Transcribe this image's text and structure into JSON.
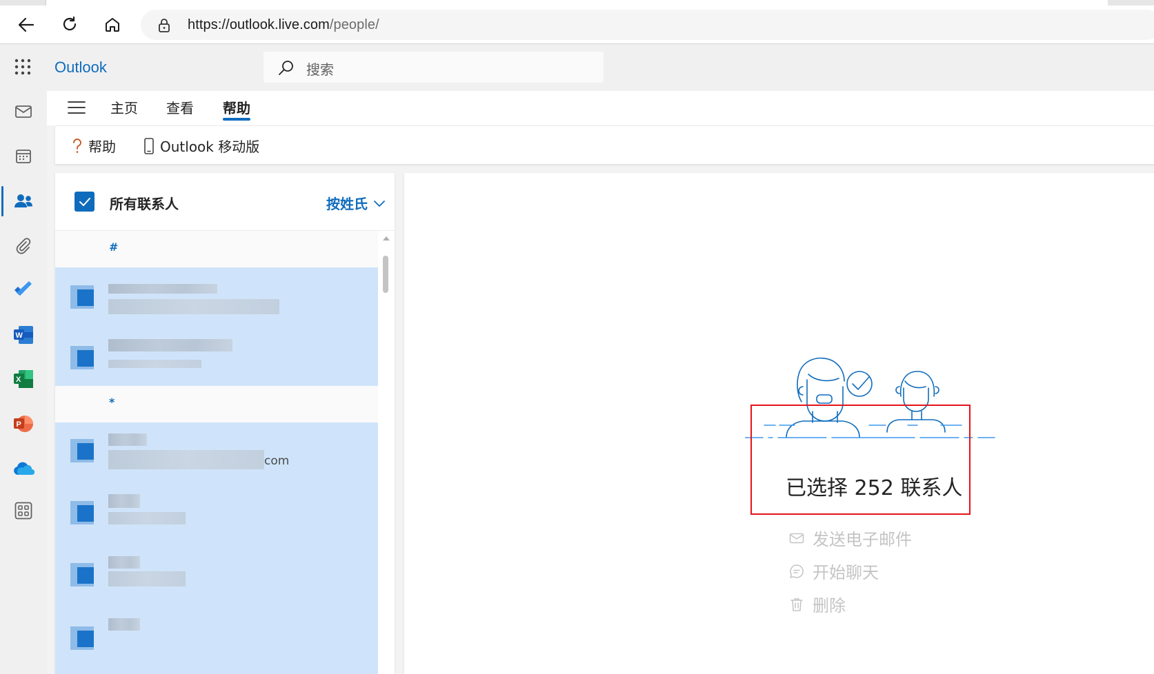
{
  "browser": {
    "url_main": "https://outlook.live.com",
    "url_path": "/people/",
    "icons": [
      "back-arrow-icon",
      "refresh-icon",
      "home-icon",
      "lock-icon"
    ]
  },
  "app": {
    "brand": "Outlook",
    "search_placeholder": "搜索",
    "accent_color": "#0f6cbd"
  },
  "rail": {
    "items": [
      "mail-icon",
      "calendar-icon",
      "people-icon",
      "attachment-icon",
      "todo-icon",
      "word-icon",
      "excel-icon",
      "powerpoint-icon",
      "onedrive-icon",
      "more-apps-icon"
    ]
  },
  "ribbon": {
    "tabs": [
      "主页",
      "查看",
      "帮助"
    ],
    "active_tab": "帮助",
    "tools": {
      "help": "帮助",
      "mobile": "Outlook 移动版"
    }
  },
  "list": {
    "title": "所有联系人",
    "sort_label": "按姓氏",
    "sections": [
      "#",
      "*"
    ],
    "email_fragment": "com"
  },
  "reading": {
    "selected_text": "已选择 252 联系人",
    "actions": [
      "发送电子邮件",
      "开始聊天",
      "删除"
    ]
  }
}
